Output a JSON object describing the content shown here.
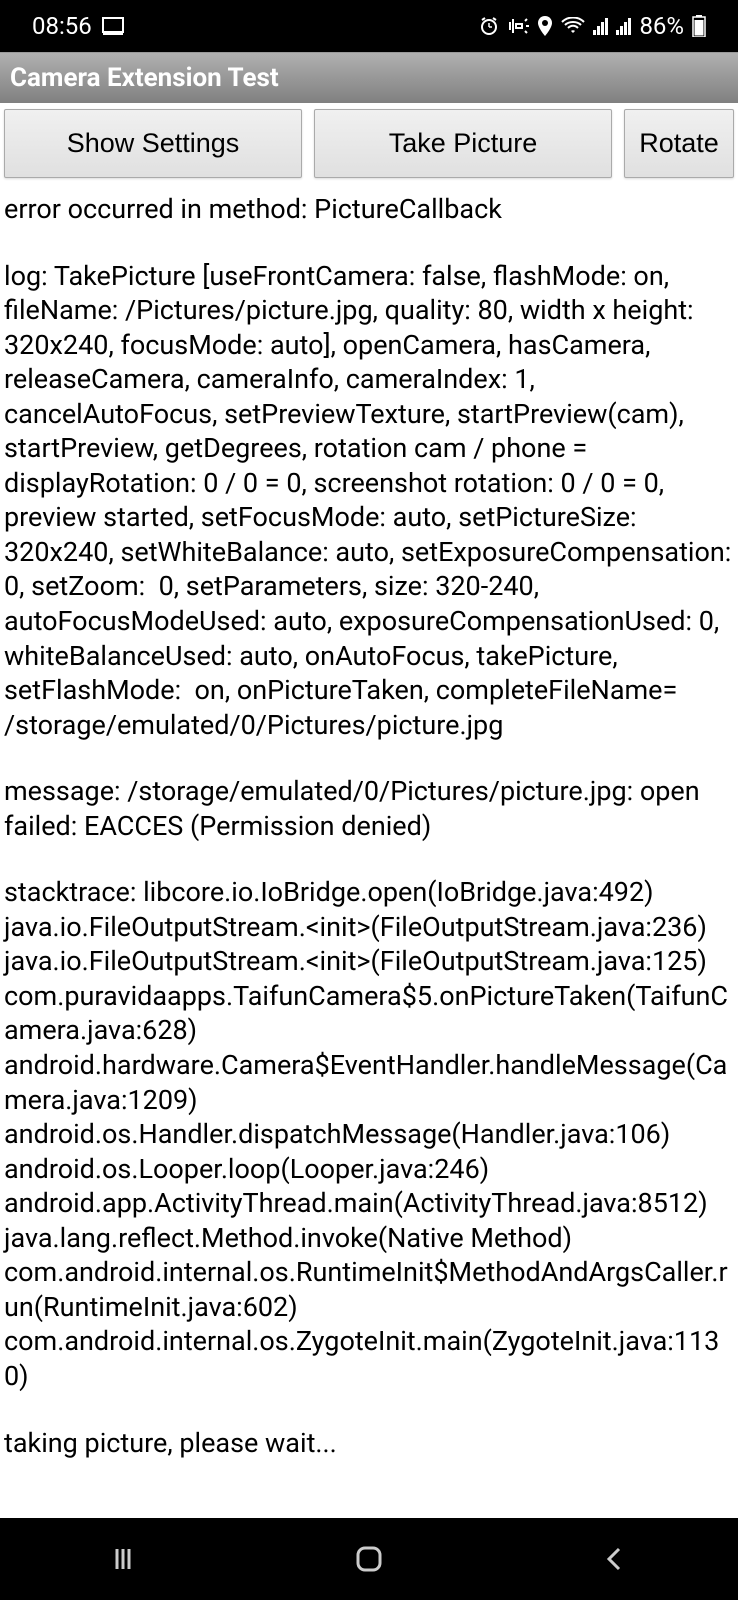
{
  "statusBar": {
    "time": "08:56",
    "battery": "86%"
  },
  "appTitle": "Camera Extension Test",
  "buttons": {
    "showSettings": "Show Settings",
    "takePicture": "Take Picture",
    "rotate": "Rotate"
  },
  "content": {
    "error": "error occurred in method: PictureCallback",
    "log": "log: TakePicture [useFrontCamera: false, flashMode: on, fileName: /Pictures/picture.jpg, quality: 80, width x height: 320x240, focusMode: auto], openCamera, hasCamera, releaseCamera, cameraInfo, cameraIndex: 1, cancelAutoFocus, setPreviewTexture, startPreview(cam), startPreview, getDegrees, rotation cam / phone = displayRotation: 0 / 0 = 0, screenshot rotation: 0 / 0 = 0, preview started, setFocusMode: auto, setPictureSize: 320x240, setWhiteBalance: auto, setExposureCompensation: 0, setZoom:  0, setParameters, size: 320-240, autoFocusModeUsed: auto, exposureCompensationUsed: 0, whiteBalanceUsed: auto, onAutoFocus, takePicture, setFlashMode:  on, onPictureTaken, completeFileName= /storage/emulated/0/Pictures/picture.jpg",
    "message": "message: /storage/emulated/0/Pictures/picture.jpg: open failed: EACCES (Permission denied)",
    "stacktrace": "stacktrace: libcore.io.IoBridge.open(IoBridge.java:492)\njava.io.FileOutputStream.<init>(FileOutputStream.java:236)\njava.io.FileOutputStream.<init>(FileOutputStream.java:125)\ncom.puravidaapps.TaifunCamera$5.onPictureTaken(TaifunCamera.java:628)\nandroid.hardware.Camera$EventHandler.handleMessage(Camera.java:1209)\nandroid.os.Handler.dispatchMessage(Handler.java:106)\nandroid.os.Looper.loop(Looper.java:246)\nandroid.app.ActivityThread.main(ActivityThread.java:8512)\njava.lang.reflect.Method.invoke(Native Method)\ncom.android.internal.os.RuntimeInit$MethodAndArgsCaller.run(RuntimeInit.java:602)\ncom.android.internal.os.ZygoteInit.main(ZygoteInit.java:1130)",
    "status": "taking picture, please wait..."
  }
}
